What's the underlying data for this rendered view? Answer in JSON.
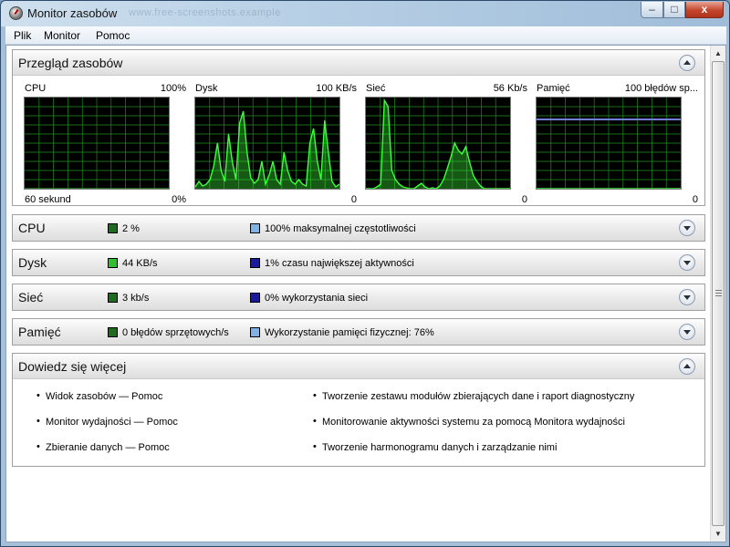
{
  "window": {
    "title": "Monitor zasobów",
    "title_ghost": "www.free-screenshots.example",
    "close_glyph": "x",
    "min_glyph": "–",
    "max_glyph": "□"
  },
  "menu": [
    "Plik",
    "Monitor",
    "Pomoc"
  ],
  "overview": {
    "title": "Przegląd zasobów",
    "graphs": [
      {
        "name": "CPU",
        "max": "100%",
        "foot_left": "60 sekund",
        "foot_right": "0%",
        "line_color": "#2f8f2f",
        "series": [
          0,
          0,
          0,
          0,
          0,
          0,
          0,
          0,
          0,
          0,
          0,
          0,
          0,
          0,
          0,
          0,
          0,
          0,
          0,
          0,
          0,
          0,
          0,
          0,
          0,
          0,
          0,
          0,
          0,
          0,
          0,
          0,
          0,
          0,
          0,
          0,
          0,
          0,
          0,
          0
        ]
      },
      {
        "name": "Dysk",
        "max": "100 KB/s",
        "foot_left": "",
        "foot_right": "0",
        "line_color": "#3cff3c",
        "series": [
          2,
          8,
          3,
          5,
          10,
          25,
          50,
          20,
          8,
          60,
          30,
          10,
          72,
          85,
          40,
          12,
          6,
          10,
          30,
          5,
          15,
          30,
          10,
          5,
          40,
          20,
          8,
          5,
          10,
          5,
          3,
          50,
          66,
          30,
          10,
          75,
          40,
          8,
          2,
          5
        ]
      },
      {
        "name": "Sieć",
        "max": "56 Kb/s",
        "foot_left": "",
        "foot_right": "0",
        "line_color": "#3cff3c",
        "series": [
          0,
          0,
          0,
          2,
          5,
          97,
          90,
          20,
          10,
          5,
          2,
          1,
          0,
          0,
          3,
          6,
          2,
          0,
          1,
          0,
          3,
          10,
          22,
          35,
          50,
          42,
          38,
          46,
          30,
          15,
          8,
          3,
          0,
          0,
          0,
          0,
          0,
          0,
          0,
          0
        ]
      },
      {
        "name": "Pamięć",
        "max": "100 błędów sp...",
        "foot_left": "",
        "foot_right": "0",
        "line_color": "#3cff3c",
        "series": [
          0,
          0,
          0,
          0,
          0,
          0,
          0,
          0,
          0,
          0,
          0,
          0,
          0,
          0,
          0,
          0,
          0,
          0,
          0,
          0,
          0,
          0,
          0,
          0,
          0,
          0,
          0,
          0,
          0,
          0,
          0,
          0,
          0,
          0,
          0,
          0,
          0,
          0,
          0,
          0
        ],
        "aux_percent": 76
      }
    ]
  },
  "sections": [
    {
      "title": "CPU",
      "m1_color": "#1f6b1f",
      "m1": "2 %",
      "m2_color": "#7fb3e6",
      "m2": "100% maksymalnej częstotliwości"
    },
    {
      "title": "Dysk",
      "m1_color": "#2fbf2f",
      "m1": "44 KB/s",
      "m2_color": "#1a1aa0",
      "m2": "1% czasu największej aktywności"
    },
    {
      "title": "Sieć",
      "m1_color": "#1f6b1f",
      "m1": "3 kb/s",
      "m2_color": "#1a1aa0",
      "m2": "0% wykorzystania sieci"
    },
    {
      "title": "Pamięć",
      "m1_color": "#1f6b1f",
      "m1": "0 błędów sprzętowych/s",
      "m2_color": "#7fb3e6",
      "m2": "Wykorzystanie pamięci fizycznej: 76%"
    }
  ],
  "learn_more": {
    "title": "Dowiedz się więcej",
    "left_links": [
      "Widok zasobów — Pomoc",
      "Monitor wydajności — Pomoc",
      "Zbieranie danych — Pomoc"
    ],
    "right_links": [
      "Tworzenie zestawu modułów zbierających dane i raport diagnostyczny",
      "Monitorowanie aktywności systemu za pomocą Monitora wydajności",
      "Tworzenie harmonogramu danych i zarządzanie nimi"
    ]
  },
  "colors": {
    "graph_bg": "#000000",
    "grid": "#1f8f1f",
    "mem_line": "#6f7fd6"
  }
}
